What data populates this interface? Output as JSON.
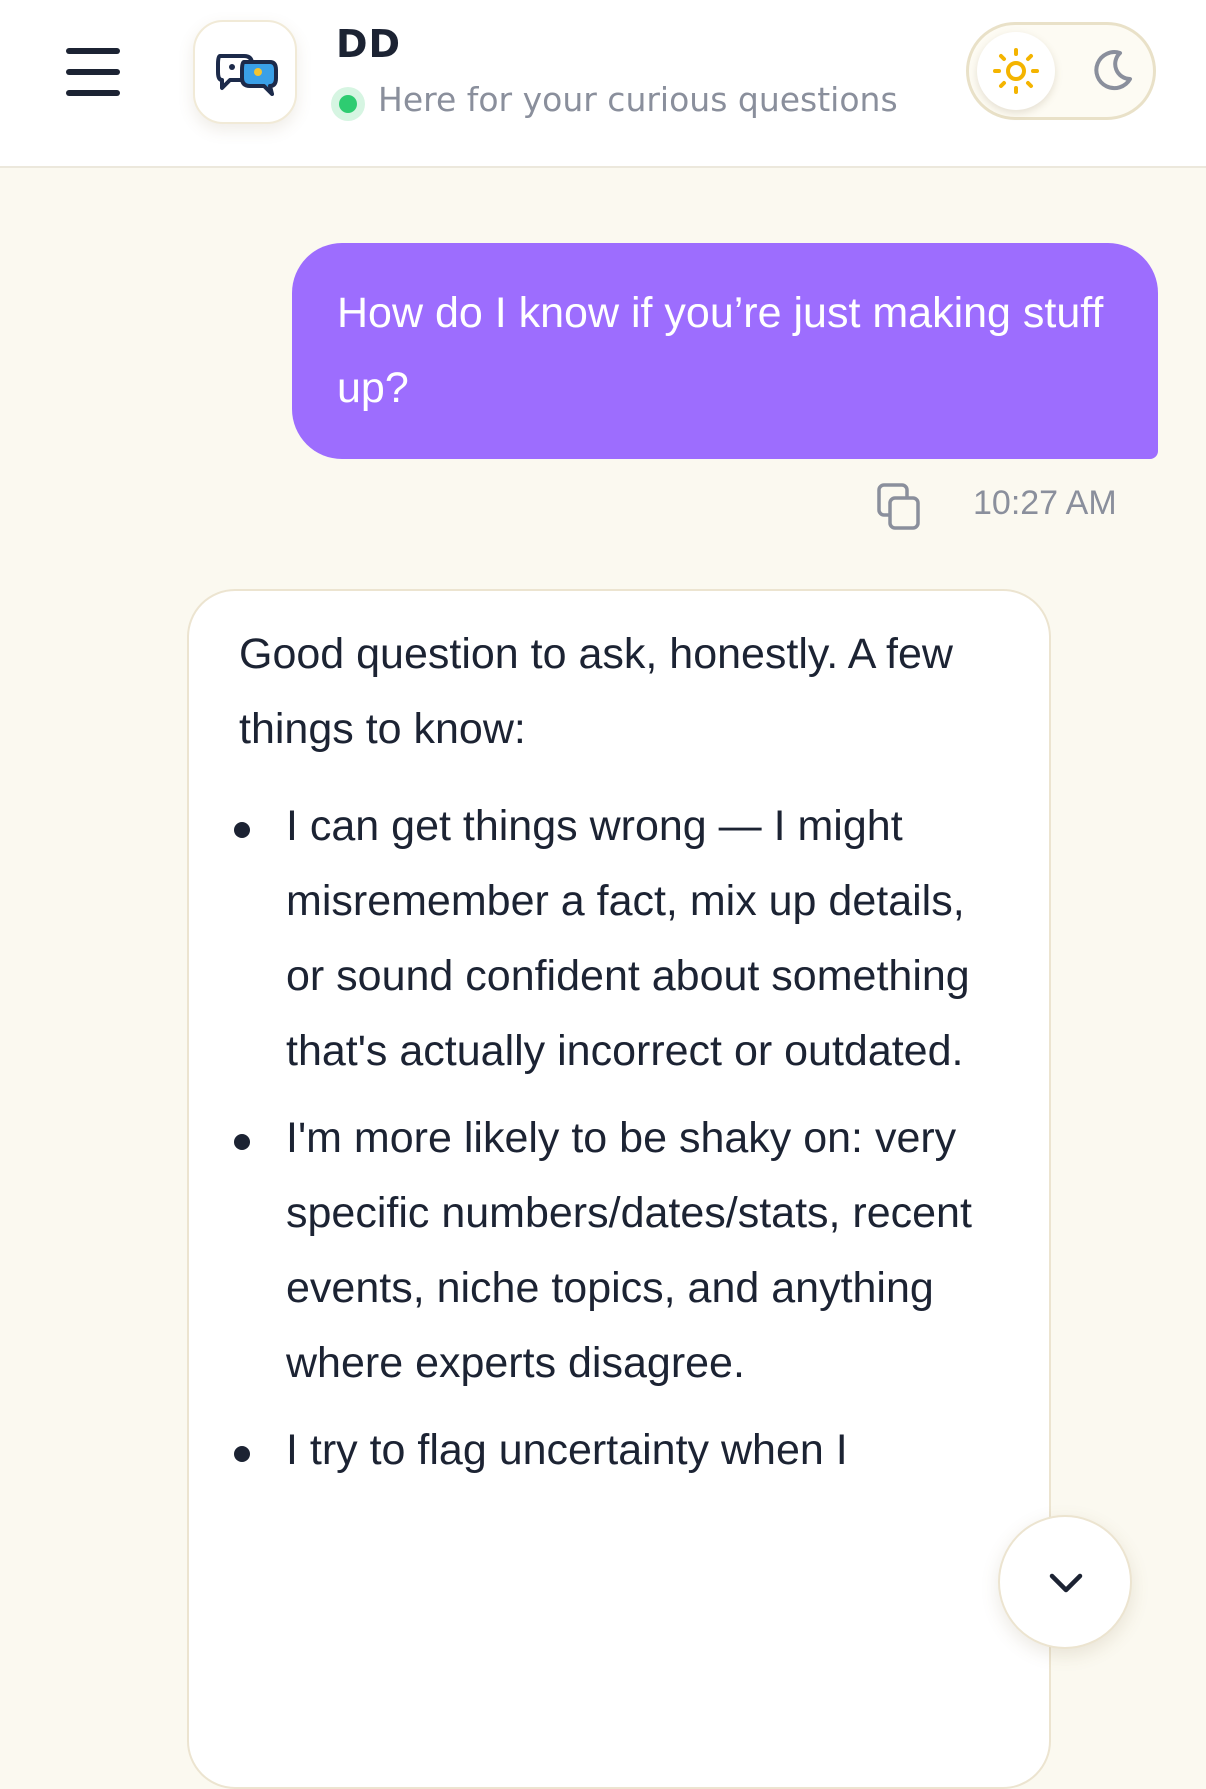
{
  "header": {
    "title": "DD",
    "status_text": "Here for your curious questions",
    "status_color": "#2ecc71",
    "menu_icon": "hamburger-menu-icon",
    "avatar_icon": "chat-bubbles-logo-icon",
    "theme_toggle": {
      "light_icon": "sun-icon",
      "dark_icon": "moon-icon",
      "selected": "light"
    }
  },
  "conversation": {
    "user_message": {
      "text": "How do I know if you’re just making stuff up?",
      "time": "10:27 AM",
      "copy_icon": "copy-icon",
      "bubble_color": "#9d6dfe"
    },
    "assistant_message": {
      "intro": "Good question to ask, honestly. A few things to know:",
      "bullets": [
        "I can get things wrong — I might misremember a fact, mix up details, or sound confident about something that's actually incorrect or outdated.",
        "I'm more likely to be shaky on: very specific numbers/dates/stats, recent events, niche topics, and anything where experts disagree.",
        "I try to flag uncertainty when I"
      ]
    }
  },
  "scroll_button": {
    "icon": "chevron-down-icon"
  },
  "colors": {
    "background": "#fbf9f0",
    "text": "#1c2333",
    "muted_text": "#8a8f9c",
    "accent": "#9d6dfe",
    "sun": "#f4b400"
  }
}
